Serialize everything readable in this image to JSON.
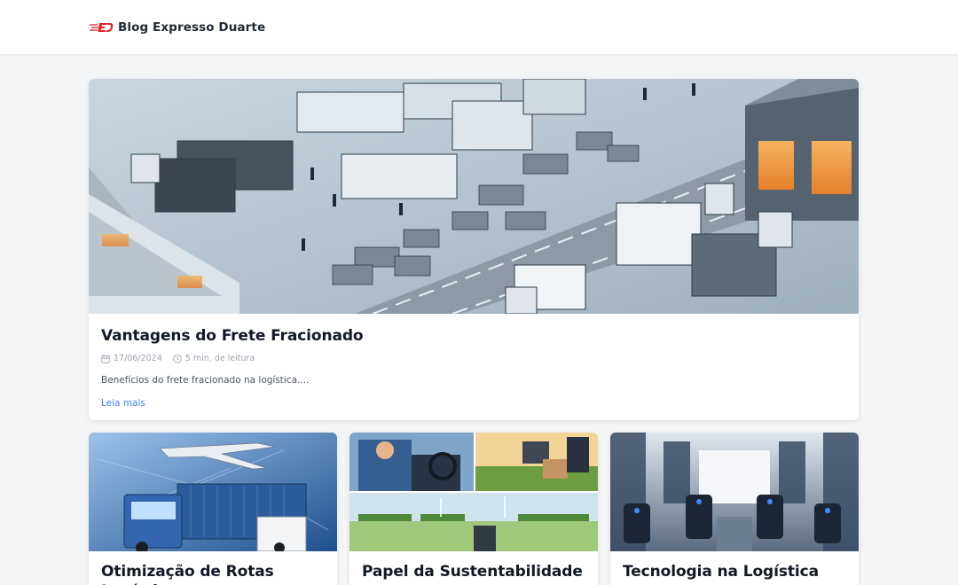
{
  "header": {
    "brand_name": "Blog Expresso Duarte",
    "logo_icon": "expresso-duarte-logo-icon",
    "accent_color": "#dc2626"
  },
  "featured": {
    "title": "Vantagens do Frete Fracionado",
    "date": "17/06/2024",
    "read_time": "5 min. de leitura",
    "excerpt": "Benefícios do frete fracionado na logística....",
    "read_more": "Leia mais",
    "image": "logistics-yard-illustration"
  },
  "posts": [
    {
      "title": "Otimização de Rotas Logísticas",
      "image": "truck-and-plane-network-image"
    },
    {
      "title": "Papel da Sustentabilidade na",
      "image": "sustainability-collage-image"
    },
    {
      "title": "Tecnologia na Logística",
      "image": "robotic-warehouse-image"
    }
  ],
  "icons": {
    "calendar": "calendar-icon",
    "clock": "clock-icon"
  },
  "colors": {
    "page_bg": "#f3f4f6",
    "card_bg": "#ffffff",
    "link": "#3b82f6",
    "muted": "#9ca3af"
  }
}
